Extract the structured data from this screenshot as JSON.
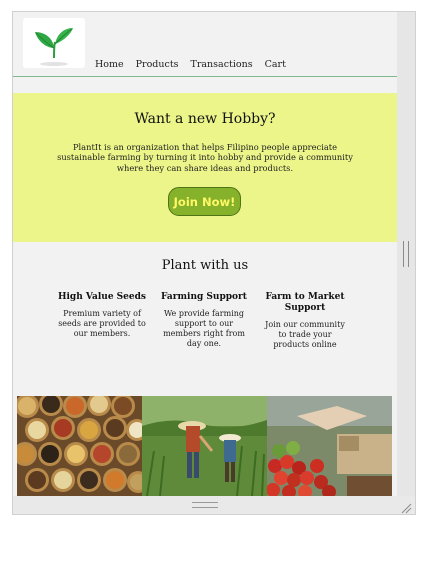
{
  "nav": {
    "items": [
      "Home",
      "Products",
      "Transactions",
      "Cart"
    ]
  },
  "hero": {
    "title": "Want a new Hobby?",
    "description": "PlantIt is an organization that helps Filipino people appreciate sustainable farming by turning it into hobby and provide a community where they can share ideas and products.",
    "cta_label": "Join Now!"
  },
  "plant_section": {
    "title": "Plant with us",
    "features": [
      {
        "title": "High Value Seeds",
        "description": "Premium variety of seeds are provided to our members."
      },
      {
        "title": "Farming Support",
        "description": "We provide farming support to our members right from day one."
      },
      {
        "title": "Farm to Market Support",
        "description": "Join our community to trade your products online"
      }
    ]
  },
  "photos": [
    {
      "icon": "seeds-photo"
    },
    {
      "icon": "farmers-photo"
    },
    {
      "icon": "market-photo"
    }
  ],
  "colors": {
    "hero_bg": "#ecf589",
    "button_bg": "#86b22b",
    "button_text": "#fff766",
    "divider": "#7fb98f"
  }
}
